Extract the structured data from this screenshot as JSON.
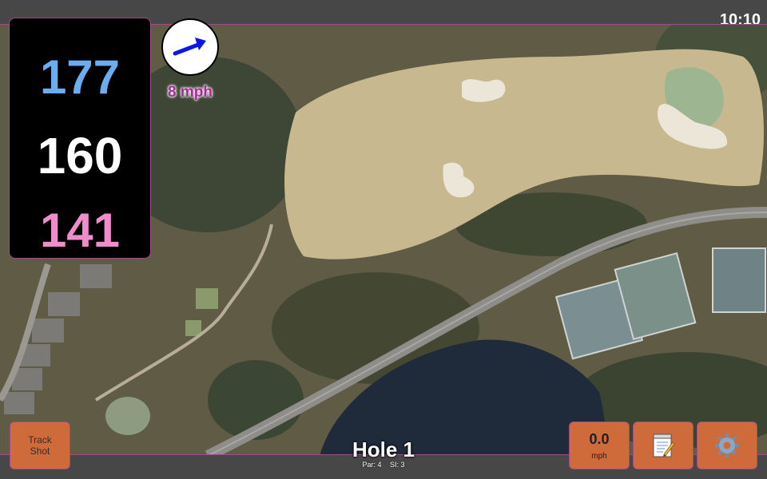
{
  "clock": "10:10",
  "distances": {
    "back": "177",
    "center": "160",
    "front": "141",
    "back_color": "#6aaef0",
    "center_color": "#ffffff",
    "front_color": "#f08ccc"
  },
  "wind": {
    "speed_label": "8 mph",
    "arrow_icon": "arrow-east-northeast-icon",
    "arrow_color": "#0a17e6"
  },
  "buttons": {
    "track_shot_line1": "Track",
    "track_shot_line2": "Shot",
    "wind_value": "0.0",
    "wind_unit": "mph",
    "notes_icon": "notepad-icon",
    "settings_icon": "gear-icon"
  },
  "hole": {
    "title": "Hole 1",
    "par_label": "Par: 4",
    "si_label": "SI: 3"
  },
  "colors": {
    "button_fill": "#cf6b3b",
    "frame_accent": "#a04c8c",
    "bar_bg": "#474747"
  }
}
